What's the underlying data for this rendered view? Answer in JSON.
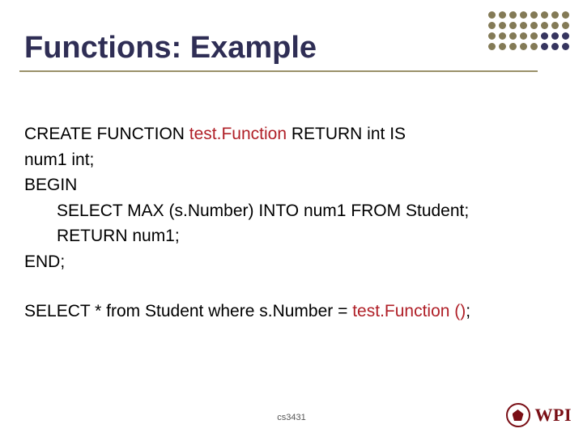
{
  "title": "Functions: Example",
  "code": {
    "l1_a": "CREATE FUNCTION ",
    "l1_fn": "test.Function",
    "l1_b": " RETURN int IS",
    "l2": "num1 int;",
    "l3": "BEGIN",
    "l4": "SELECT MAX (s.Number) INTO num1 FROM Student;",
    "l5": "RETURN num1;",
    "l6": "END;",
    "q_a": "SELECT * from Student where s.Number = ",
    "q_fn": "test.Function ()",
    "q_b": ";"
  },
  "footer": "cs3431",
  "logo_text": "WPI"
}
